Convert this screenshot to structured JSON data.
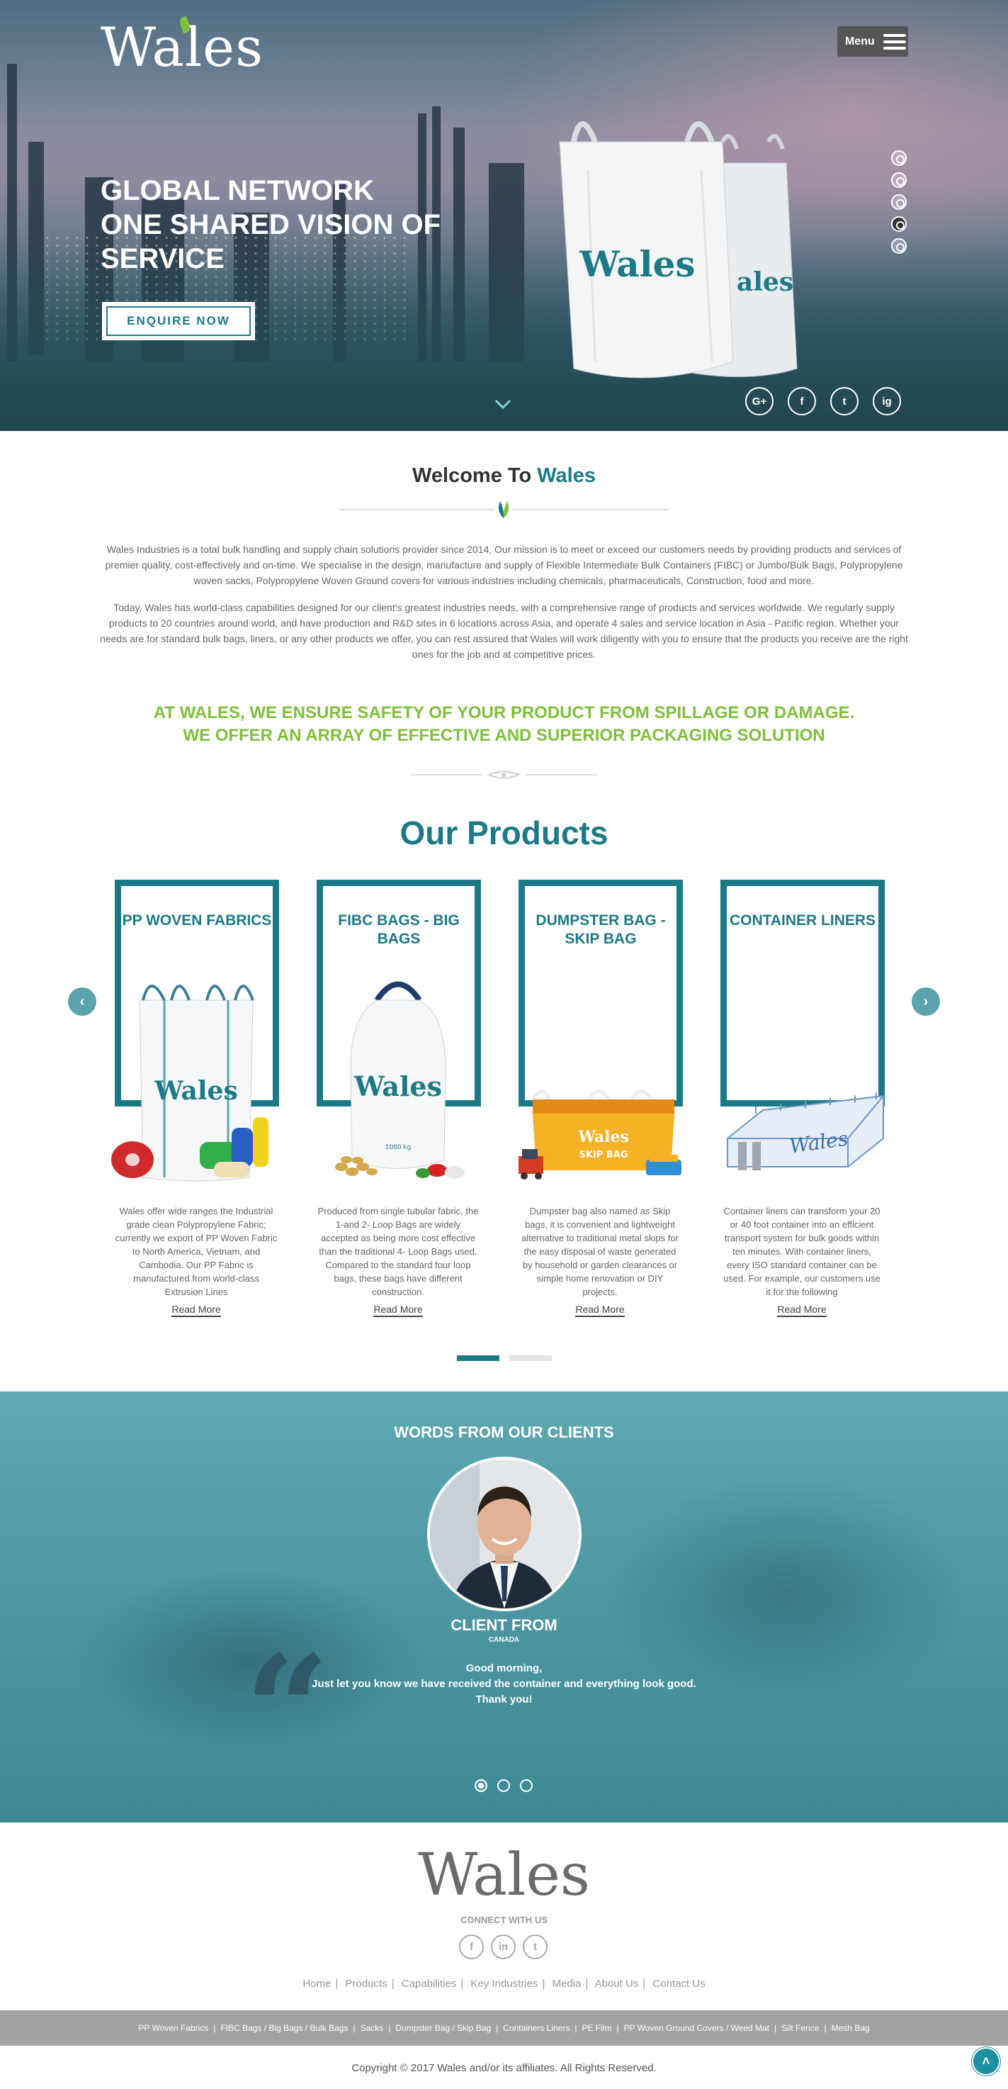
{
  "header": {
    "logo_text": "Wales",
    "menu_label": "Menu"
  },
  "hero": {
    "title_lines": [
      "GLOBAL NETWORK",
      "ONE SHARED VISION OF",
      "SERVICE"
    ],
    "cta_label": "ENQUIRE NOW",
    "bag_brand": "Wales",
    "slides_total": 5,
    "active_slide": 4,
    "social": [
      "G+",
      "f",
      "t",
      "ig"
    ]
  },
  "welcome": {
    "title_prefix": "Welcome To ",
    "title_brand": "Wales",
    "para1": "Wales Industries is a total bulk handling and supply chain solutions provider since 2014, Our mission is to meet or exceed our customers needs by providing products and services of premier quality, cost-effectively and on-time. We specialise in the design, manufacture and supply of Flexible Intermediate Bulk Containers (FIBC) or Jumbo/Bulk Bags, Polypropylene woven sacks, Polypropylene Woven Ground covers for various industries including chemicals, pharmaceuticals, Construction, food and more.",
    "para2": "Today, Wales has world-class capabilities designed for our client's greatest industries needs, with a comprehensive range of products and services worldwide. We regularly supply products to 20 countries around world, and have production and R&D sites in 6 locations across Asia, and operate 4 sales and service location in Asia - Pacific region. Whether your needs are for standard bulk bags, liners, or any other products we offer, you can rest assured that Wales will work diligently with you to ensure that the products you receive are the right ones for the job and at competitive prices.",
    "safety_line1": "AT WALES, WE ENSURE SAFETY OF YOUR PRODUCT FROM SPILLAGE OR DAMAGE.",
    "safety_line2": "WE OFFER AN ARRAY OF EFFECTIVE AND SUPERIOR PACKAGING SOLUTION"
  },
  "products": {
    "title": "Our Products",
    "read_more": "Read More",
    "items": [
      {
        "title": "PP WOVEN FABRICS",
        "image_text": "Wales",
        "desc": "Wales offer wide ranges the Industrial grade clean Polypropylene Fabric; currently we export of PP Woven Fabric to North America, Vietnam, and Cambodia. Our PP Fabric is manufactured from world-class Extrusion Lines"
      },
      {
        "title": "FIBC BAGS - BIG BAGS",
        "image_text": "Wales",
        "image_sub": "1000 kg",
        "desc": "Produced from single tubular fabric, the 1-and 2- Loop Bags are widely accepted as being more cost effective than the traditional 4- Loop Bags used. Compared to the standard four loop bags, these bags have different construction."
      },
      {
        "title": "DUMPSTER BAG - SKIP BAG",
        "image_text": "Wales",
        "image_sub": "SKIP BAG",
        "desc": "Dumpster bag also named as Skip bags, it is convenient and lightweight alternative to traditional metal skips for the easy disposal of waste generated by household or garden clearances or simple home renovation or DIY projects."
      },
      {
        "title": "CONTAINER LINERS",
        "image_text": "Wales",
        "desc": "Container liners can transform your 20 or 40 foot container into an efficient transport system for bulk goods within ten minutes. With container liners, every ISO standard container can be used. For example, our customers use it for the following"
      }
    ],
    "pages_total": 2,
    "active_page": 1
  },
  "testimonials": {
    "title": "WORDS FROM OUR CLIENTS",
    "client_name": "CLIENT FROM",
    "client_location": "CANADA",
    "quote_lines": [
      "Good morning,",
      "Just let you know we have received the container and everything look good.",
      "Thank you!"
    ],
    "dots_total": 3,
    "active_dot": 1
  },
  "footer": {
    "logo_text": "Wales",
    "connect_label": "CONNECT WITH US",
    "social": [
      "f",
      "in",
      "t"
    ],
    "nav": [
      "Home",
      "Products",
      "Capabilities",
      "Key Industries",
      "Media",
      "About Us",
      "Contact Us"
    ],
    "product_links": [
      "PP Woven Fabrics",
      "FIBC Bags / Big Bags / Bulk Bags",
      "Sacks",
      "Dumpster Bag / Skip Bag",
      "Containers Liners",
      "PE Film",
      "PP Woven Ground Covers / Weed Mat",
      "Silt Fence",
      "Mesh Bag"
    ],
    "copyright": "Copyright © 2017 Wales and/or its affiliates. All Rights Reserved."
  },
  "colors": {
    "brand_teal": "#1c7a87",
    "accent_green": "#7fbf3a",
    "footer_bar": "#a3a3a3"
  }
}
